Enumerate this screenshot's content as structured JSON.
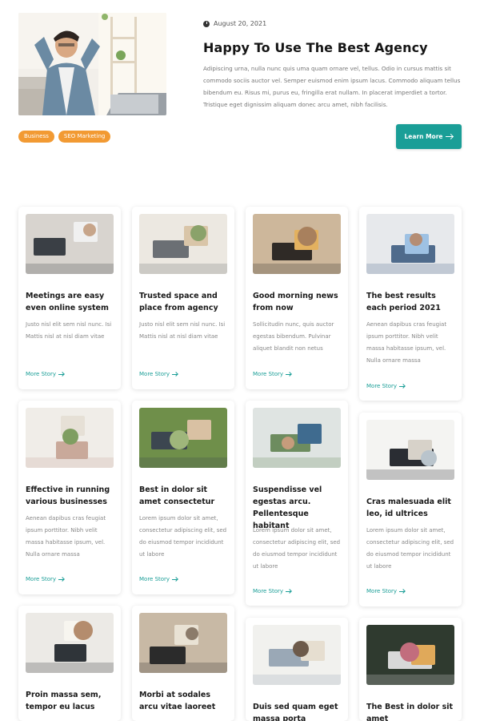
{
  "featured": {
    "date": "August 20, 2021",
    "title": "Happy To Use The Best Agency",
    "excerpt": "Adipiscing urna, nulla nunc quis uma quam ornare vel, tellus. Odio in cursus mattis sit commodo sociis auctor vel. Semper euismod enim ipsum lacus. Commodo aliquam tellus bibendum eu. Risus mi, purus eu, fringilla erat nullam. In placerat imperdiet a tortor. Tristique eget dignissim aliquam donec arcu amet, nibh facilisis.",
    "tags": [
      "Business",
      "SEO Marketing"
    ],
    "button_label": "Learn More",
    "icon": "clock-icon",
    "image": "man-relaxing-at-laptop-photo"
  },
  "colors": {
    "accent": "#1a9e97",
    "tag": "#f29a33"
  },
  "cards": [
    {
      "title": "Meetings are easy even online system",
      "excerpt": "Justo nisl elit sem nisl nunc. Isi Mattis nisl at nisl diam vitae",
      "more": "More Story",
      "image": "hands-laptops-meeting"
    },
    {
      "title": "Trusted space and place from agency",
      "excerpt": "Justo nisl elit sem nisl nunc. Isi Mattis nisl at nisl diam vitae",
      "more": "More Story",
      "image": "office-interior"
    },
    {
      "title": "Good morning news from now",
      "excerpt": "Sollicitudin nunc, quis auctor egestas bibendum. Pulvinar aliquet blandit non netus",
      "more": "More Story",
      "image": "smiling-man-laptop"
    },
    {
      "title": "The best results each period 2021",
      "excerpt": "Aenean dapibus cras feugiat ipsum porttitor. Nibh velit massa habitasse ipsum, vel. Nulla ornare massa",
      "more": "More Story",
      "image": "charts-on-laptop"
    },
    {
      "title": "Effective in running various businesses",
      "excerpt": "Aenean dapibus cras feugiat ipsum porttitor. Nibh velit massa habitasse ipsum, vel. Nulla ornare massa",
      "more": "More Story",
      "image": "living-room-sofa"
    },
    {
      "title": "Best in dolor sit amet consectetur",
      "excerpt": "Lorem ipsum dolor sit amet, consectetur adipiscing elit, sed do eiusmod tempor incididunt ut labore",
      "more": "More Story",
      "image": "team-meeting-table"
    },
    {
      "title": "Suspendisse vel egestas arcu. Pellentesque habitant",
      "excerpt": "Lorem ipsum dolor sit amet, consectetur adipiscing elit, sed do eiusmod tempor incididunt ut labore",
      "more": "More Story",
      "image": "coworkers-plants"
    },
    {
      "title": "Cras malesuada elit leo, id ultrices",
      "excerpt": "Lorem ipsum dolor sit amet, consectetur adipiscing elit, sed do eiusmod tempor incididunt ut labore",
      "more": "More Story",
      "image": "businessmen-discussion"
    },
    {
      "title": "Proin massa sem, tempor eu lacus",
      "excerpt": "",
      "more": "",
      "image": "notebook-keyboard"
    },
    {
      "title": "Morbi at sodales arcu vitae laoreet",
      "excerpt": "",
      "more": "",
      "image": "desk-items-flatlay"
    },
    {
      "title": "Duis sed quam eget massa porta",
      "excerpt": "",
      "more": "",
      "image": "papers-coffee"
    },
    {
      "title": "The Best in dolor sit amet",
      "excerpt": "",
      "more": "",
      "image": "hands-laptop-flowers"
    }
  ]
}
